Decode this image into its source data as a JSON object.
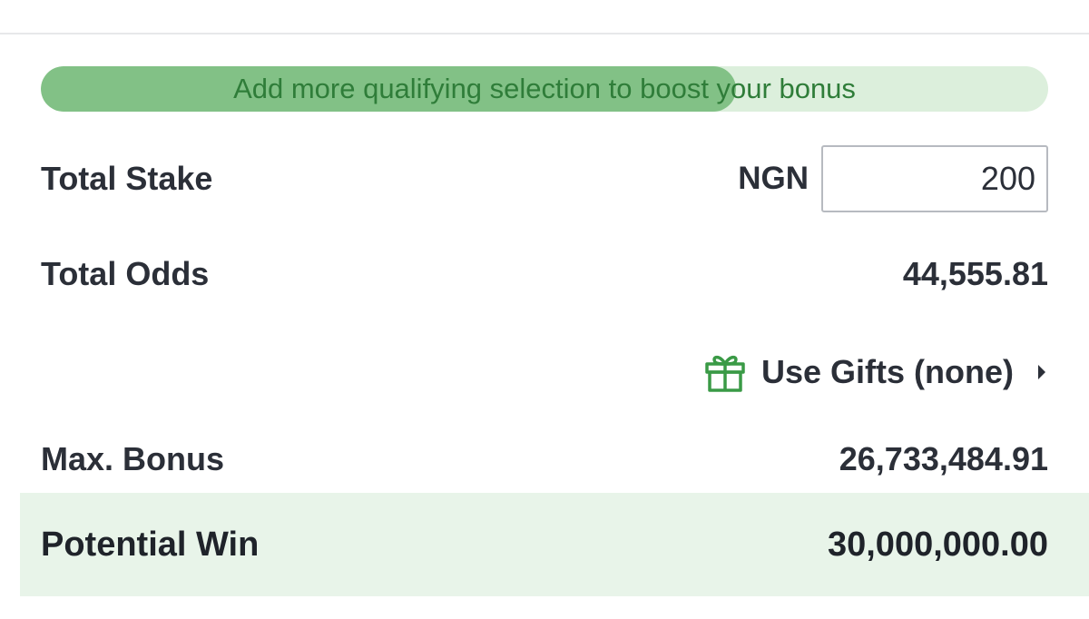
{
  "bonus_banner": {
    "message": "Add more qualifying selection to boost your bonus",
    "progress_fraction": 0.69,
    "track_color": "#dcefdc",
    "fill_color": "#82c186",
    "text_color": "#2f7d39"
  },
  "stake": {
    "label": "Total Stake",
    "currency": "NGN",
    "value": "200"
  },
  "odds": {
    "label": "Total Odds",
    "value": "44,555.81"
  },
  "gifts": {
    "icon": "gift-icon",
    "label": "Use Gifts (none)",
    "chevron_icon": "caret-right-icon",
    "icon_color": "#3a9a46"
  },
  "max_bonus": {
    "label": "Max. Bonus",
    "value": "26,733,484.91"
  },
  "potential_win": {
    "label": "Potential Win",
    "value": "30,000,000.00",
    "background_color": "#e8f4e9"
  }
}
